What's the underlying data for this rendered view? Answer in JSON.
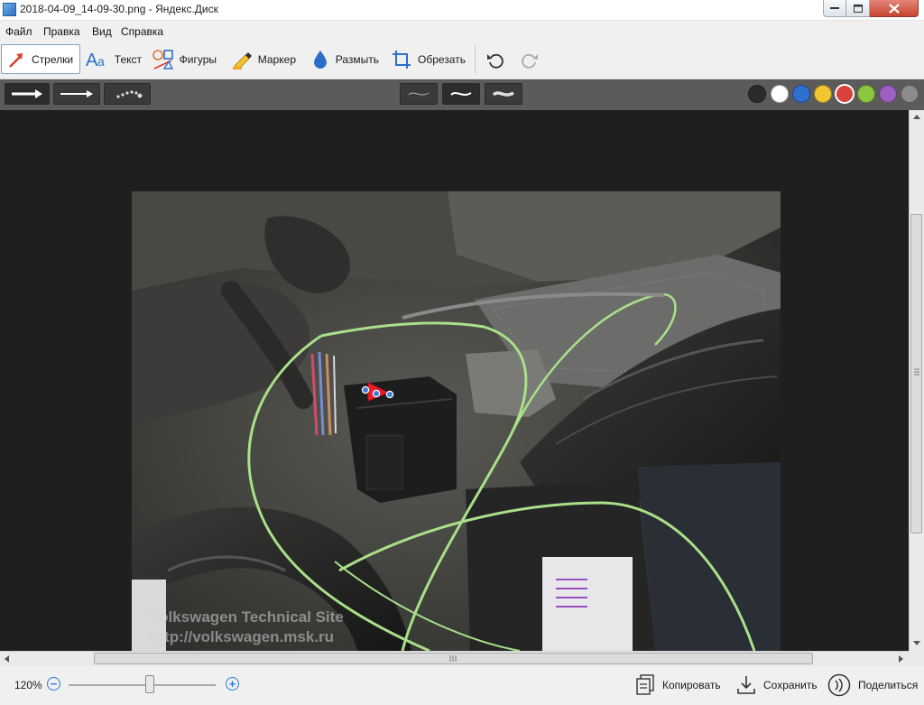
{
  "window": {
    "title": "2018-04-09_14-09-30.png - Яндекс.Диск"
  },
  "menu": [
    "Файл",
    "Правка",
    "Вид",
    "Справка"
  ],
  "toolbar": {
    "tools": [
      {
        "label": "Стрелки",
        "icon": "arrow-tool-icon",
        "active": true
      },
      {
        "label": "Текст",
        "icon": "text-tool-icon"
      },
      {
        "label": "Фигуры",
        "icon": "shapes-tool-icon"
      },
      {
        "label": "Маркер",
        "icon": "marker-tool-icon"
      },
      {
        "label": "Размыть",
        "icon": "blur-tool-icon"
      },
      {
        "label": "Обрезать",
        "icon": "crop-tool-icon"
      }
    ],
    "undo_icon": "undo-icon",
    "redo_icon": "redo-icon"
  },
  "subbar": {
    "arrow_styles": [
      "arrow-straight-bold",
      "arrow-straight-thin",
      "arrow-dotted"
    ],
    "thickness_options": [
      "thin",
      "medium",
      "thick"
    ],
    "selected_thickness": "medium",
    "colors": [
      "#2b2b2b",
      "#ffffff",
      "#2f6fd0",
      "#f2c530",
      "#d9413a",
      "#8dc63f",
      "#9a5fc0",
      "#8c8c8c"
    ],
    "selected_color": "#d9413a"
  },
  "photo": {
    "watermark_line1": "Volkswagen Technical Site",
    "watermark_line2": "http://volkswagen.msk.ru"
  },
  "status": {
    "zoom": "120%",
    "zoom_level": 0.55,
    "actions": [
      {
        "label": "Копировать",
        "icon": "copy-icon"
      },
      {
        "label": "Сохранить",
        "icon": "save-icon"
      },
      {
        "label": "Поделиться",
        "icon": "share-icon"
      }
    ]
  }
}
